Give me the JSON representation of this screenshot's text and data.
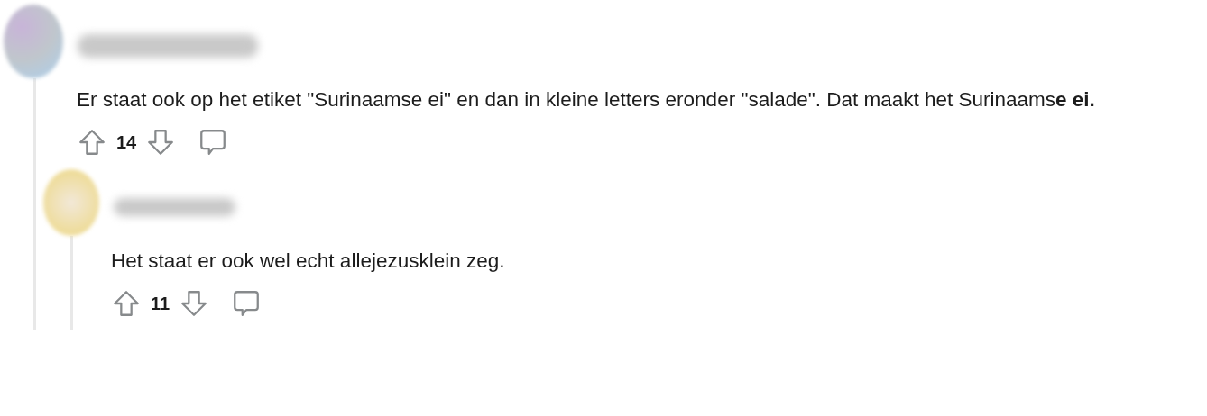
{
  "comments": [
    {
      "body": "Er staat ook op het etiket \"Surinaamse ei\" en dan in kleine letters eronder \"salade\". Dat maakt het Surinaams**e ei.**",
      "score": "14",
      "children": [
        {
          "body": "Het staat er ook wel echt allejezusklein zeg.",
          "score": "11"
        }
      ]
    }
  ]
}
